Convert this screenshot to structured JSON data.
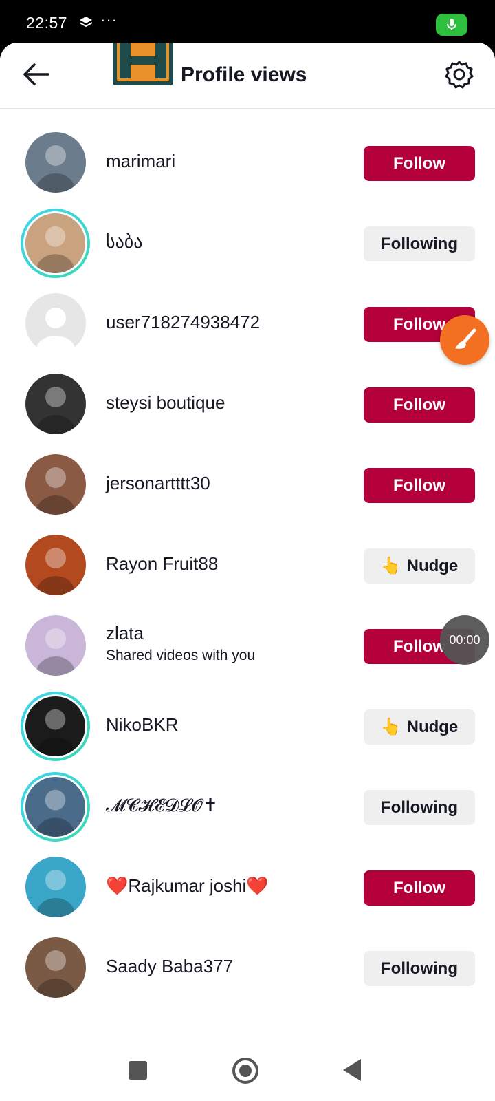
{
  "status_bar": {
    "time": "22:57",
    "dots": "···",
    "layers_icon": "layers-icon",
    "mic_icon": "microphone-icon",
    "mic_color": "#2fbf3e"
  },
  "header": {
    "title": "Profile views",
    "back_icon": "arrow-left-icon",
    "settings_icon": "gear-icon"
  },
  "colors": {
    "follow_bg": "#b4003a",
    "secondary_bg": "#efefef",
    "ring": "#3fd4f0"
  },
  "users": [
    {
      "name": "marimari",
      "button": "Follow",
      "type": "follow",
      "ring": false,
      "avatar": "photo"
    },
    {
      "name": "საბა",
      "button": "Following",
      "type": "following",
      "ring": true,
      "avatar": "photo"
    },
    {
      "name": "user718274938472",
      "button": "Follow",
      "type": "follow",
      "ring": false,
      "avatar": "default"
    },
    {
      "name": "steysi boutique",
      "button": "Follow",
      "type": "follow",
      "ring": false,
      "avatar": "photo"
    },
    {
      "name": "jersonartttt30",
      "button": "Follow",
      "type": "follow",
      "ring": false,
      "avatar": "photo"
    },
    {
      "name": "Rayon Fruit88",
      "button": "Nudge",
      "type": "nudge",
      "ring": false,
      "avatar": "photo"
    },
    {
      "name": "zlata",
      "subtitle": "Shared videos with you",
      "button": "Follow",
      "type": "follow",
      "ring": false,
      "avatar": "photo"
    },
    {
      "name": "NikoBKR",
      "button": "Nudge",
      "type": "nudge",
      "ring": true,
      "avatar": "photo"
    },
    {
      "name": "𝓜𝓒𝓗𝓔𝓓𝓛𝓞✝",
      "button": "Following",
      "type": "following",
      "ring": true,
      "avatar": "photo"
    },
    {
      "name": "❤️Rajkumar joshi❤️",
      "button": "Follow",
      "type": "follow",
      "ring": false,
      "avatar": "photo"
    },
    {
      "name": "Saady Baba377",
      "button": "Following",
      "type": "following",
      "ring": false,
      "avatar": "photo"
    }
  ],
  "nudge_emoji": "👆",
  "floating": {
    "brush_icon": "paintbrush-icon",
    "timer": "00:00"
  },
  "navbar": {
    "recents_icon": "square-icon",
    "home_icon": "circle-icon",
    "back_icon": "triangle-back-icon"
  }
}
